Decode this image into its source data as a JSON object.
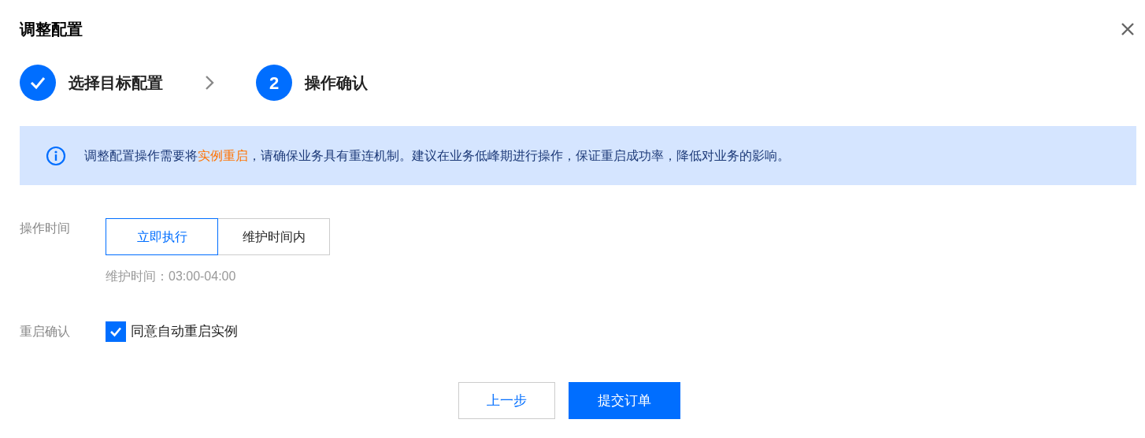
{
  "dialog": {
    "title": "调整配置"
  },
  "steps": [
    {
      "label": "选择目标配置",
      "done": true
    },
    {
      "label": "操作确认",
      "done": false,
      "number": "2"
    }
  ],
  "alert": {
    "segments": [
      {
        "kind": "plain",
        "text": "调整配置操作需要将"
      },
      {
        "kind": "highlight",
        "text": "实例重启"
      },
      {
        "kind": "plain",
        "text": "，请确保业务具有重连机制。建议在业务低峰期进行操作，保证重启成功率，降低对业务的影响。"
      }
    ]
  },
  "operation_time": {
    "label": "操作时间",
    "options": [
      {
        "label": "立即执行",
        "selected": true
      },
      {
        "label": "维护时间内",
        "selected": false
      }
    ],
    "hint": "维护时间：03:00-04:00"
  },
  "restart_confirm": {
    "label": "重启确认",
    "checkbox": {
      "label": "同意自动重启实例",
      "checked": true
    }
  },
  "buttons": [
    {
      "label": "上一步",
      "kind": "secondary"
    },
    {
      "label": "提交订单",
      "kind": "primary"
    }
  ]
}
